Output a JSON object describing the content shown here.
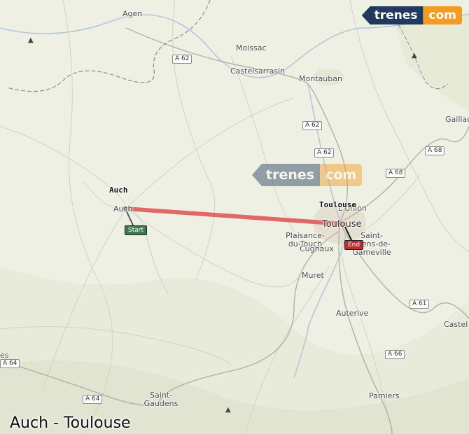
{
  "brand": {
    "part1": "trenes",
    "part2": "com"
  },
  "watermark": {
    "part1": "trenes",
    "part2": "com"
  },
  "route_title": "Auch - Toulouse",
  "origin": {
    "name": "Auch",
    "pin_label": "Start"
  },
  "destination": {
    "name": "Toulouse",
    "pin_label": "End"
  },
  "colors": {
    "route": "#e05a5a",
    "start": "#3d7a4e",
    "end": "#b3302c",
    "brand_dark": "#1f3a5c",
    "brand_orange": "#f39c1f"
  },
  "places": {
    "agen": "Agen",
    "moissac": "Moissac",
    "castelsarrasin": "Castelsarrasin",
    "montauban": "Montauban",
    "gaillac": "Gaillac",
    "auch_map": "Auch",
    "toulouse_map": "Toulouse",
    "lunion": "L'Union",
    "plaisance": "Plaisance-du-Touch",
    "cugnaux": "Cugnaux",
    "saint_orens": "Saint-Orens-de-Gameville",
    "muret": "Muret",
    "auterive": "Auterive",
    "castel": "Castel",
    "saint_gaudens": "Saint-Gaudens",
    "pamiers": "Pamiers",
    "es": "es"
  },
  "highways": {
    "a62_1": "A 62",
    "a62_2": "A 62",
    "a62_3": "A 62",
    "a68_1": "A 68",
    "a68_2": "A 68",
    "a61": "A 61",
    "a66": "A 66",
    "a64_1": "A 64",
    "a64_2": "A 64"
  }
}
